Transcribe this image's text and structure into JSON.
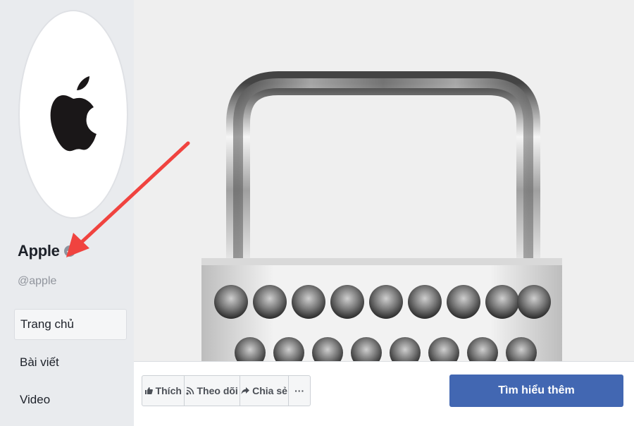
{
  "page": {
    "name": "Apple",
    "handle": "@apple",
    "verified": true,
    "accent_color": "#4267b2"
  },
  "sidebar": {
    "items": [
      {
        "label": "Trang chủ",
        "active": true
      },
      {
        "label": "Bài viết",
        "active": false
      },
      {
        "label": "Video",
        "active": false
      }
    ]
  },
  "actions": {
    "like_label": "Thích",
    "follow_label": "Theo dõi",
    "share_label": "Chia sẻ",
    "more_label": "···",
    "cta_label": "Tìm hiểu thêm"
  },
  "annotation": {
    "color": "#f0433f"
  }
}
